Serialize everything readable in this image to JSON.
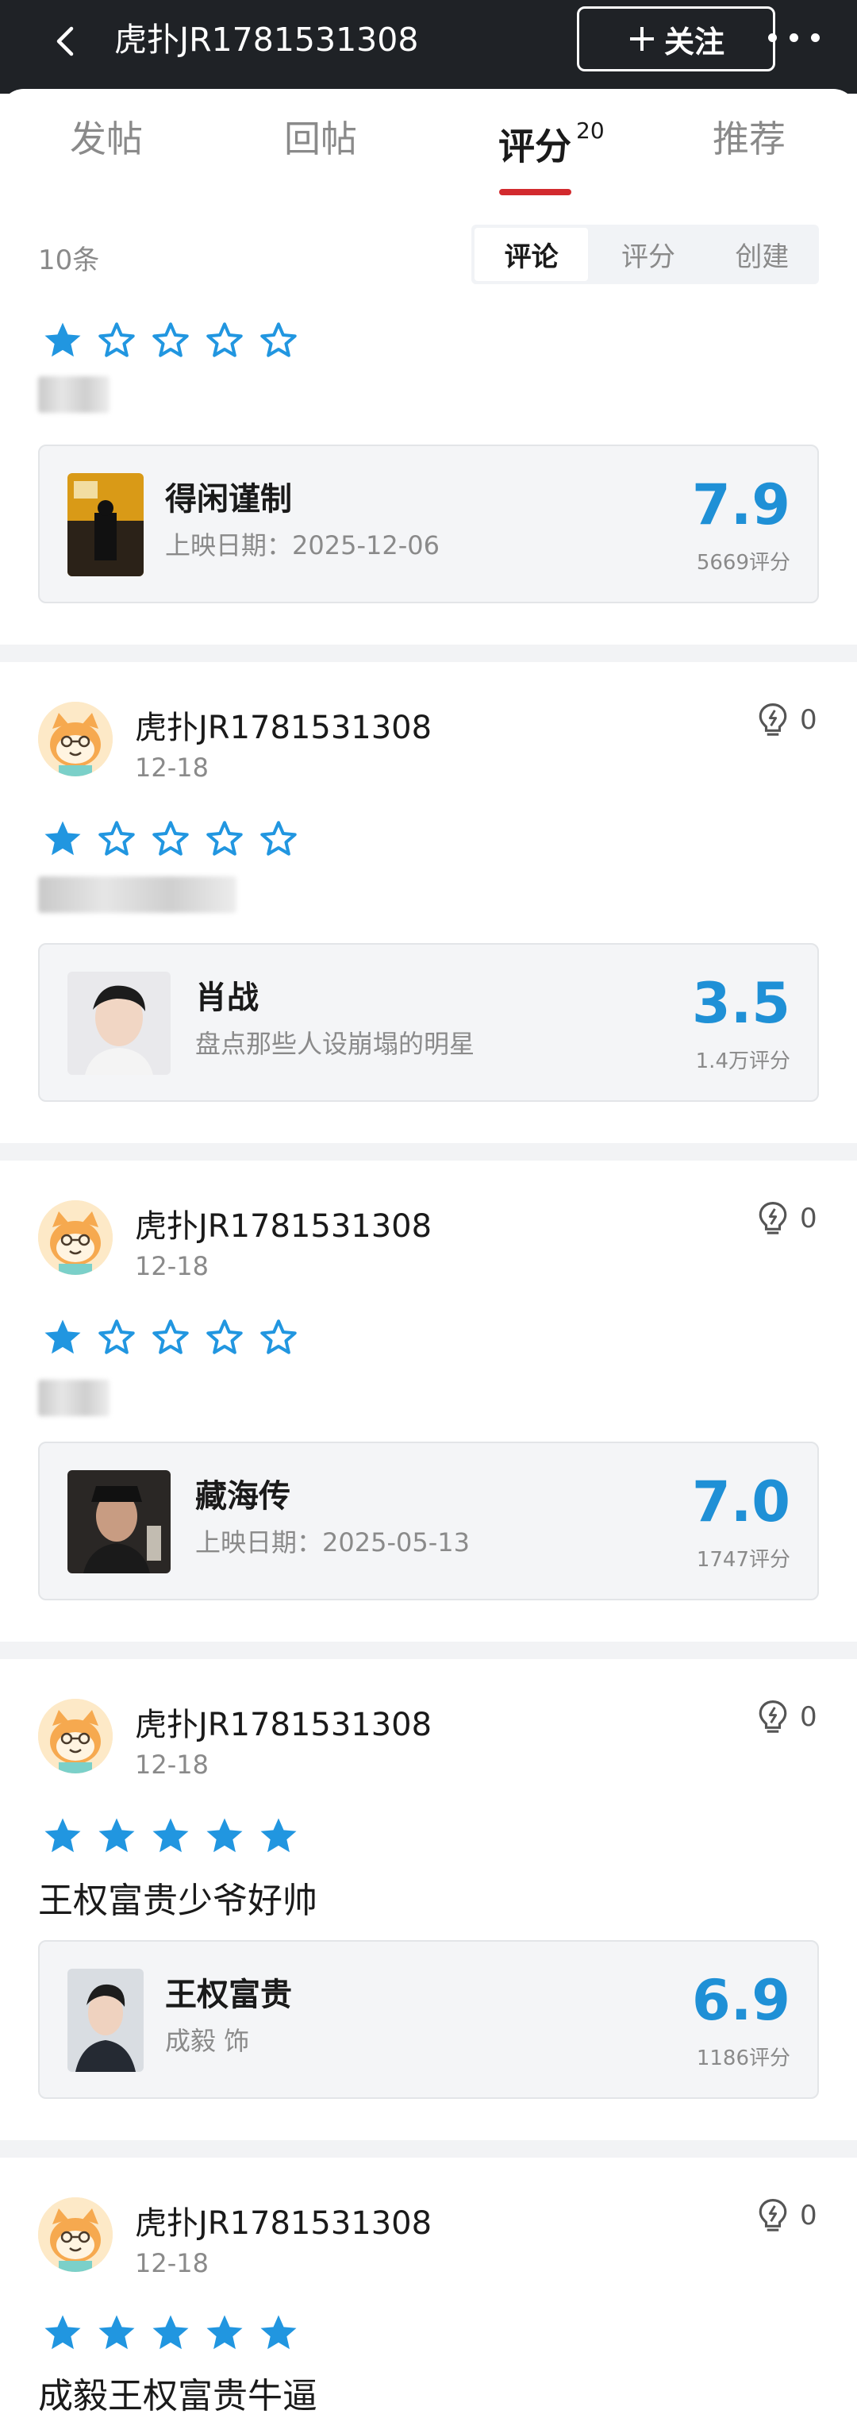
{
  "topbar": {
    "title": "虎扑JR1781531308",
    "follow_label": "关注"
  },
  "tabs": [
    {
      "label": "发帖"
    },
    {
      "label": "回帖"
    },
    {
      "label": "评分",
      "badge": "20"
    },
    {
      "label": "推荐"
    }
  ],
  "list": {
    "count": "10条"
  },
  "segments": [
    "评论",
    "评分",
    "创建"
  ],
  "posts": [
    {
      "stars": 1,
      "item": {
        "title": "得闲谨制",
        "subtitle": "上映日期：2025-12-06",
        "score": "7.9",
        "count": "5669评分"
      }
    },
    {
      "user": "虎扑JR1781531308",
      "date": "12-18",
      "likes": "0",
      "stars": 1,
      "item": {
        "title": "肖战",
        "subtitle": "盘点那些人设崩塌的明星",
        "score": "3.5",
        "count": "1.4万评分"
      }
    },
    {
      "user": "虎扑JR1781531308",
      "date": "12-18",
      "likes": "0",
      "stars": 1,
      "item": {
        "title": "藏海传",
        "subtitle": "上映日期：2025-05-13",
        "score": "7.0",
        "count": "1747评分"
      }
    },
    {
      "user": "虎扑JR1781531308",
      "date": "12-18",
      "likes": "0",
      "stars": 5,
      "comment": "王权富贵少爷好帅",
      "item": {
        "title": "王权富贵",
        "subtitle": "成毅 饰",
        "score": "6.9",
        "count": "1186评分"
      }
    },
    {
      "user": "虎扑JR1781531308",
      "date": "12-18",
      "likes": "0",
      "stars": 5,
      "comment": "成毅王权富贵牛逼"
    }
  ],
  "colors": {
    "accent": "#1f90d6",
    "star": "#2196e0",
    "tab_underline": "#d22a2e",
    "topbar": "#1f2226"
  },
  "icons": [
    "back-arrow-icon",
    "plus-icon",
    "more-icon",
    "lightbulb-icon",
    "star-icon",
    "avatar-cat-icon"
  ]
}
